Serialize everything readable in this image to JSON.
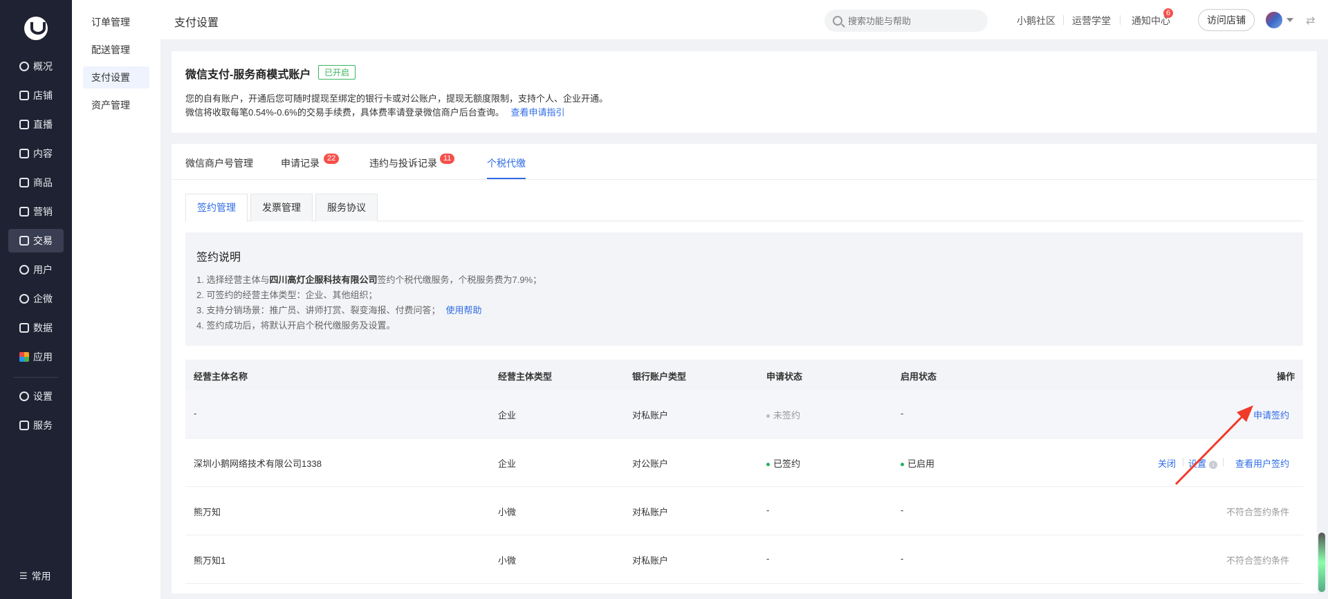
{
  "nav": {
    "items": [
      {
        "label": "概况",
        "icon": "clock-icon"
      },
      {
        "label": "店铺",
        "icon": "store-icon"
      },
      {
        "label": "直播",
        "icon": "live-icon"
      },
      {
        "label": "内容",
        "icon": "document-icon"
      },
      {
        "label": "商品",
        "icon": "box-icon"
      },
      {
        "label": "营销",
        "icon": "megaphone-icon"
      },
      {
        "label": "交易",
        "icon": "exchange-icon"
      },
      {
        "label": "用户",
        "icon": "user-icon"
      },
      {
        "label": "企微",
        "icon": "chat-icon"
      },
      {
        "label": "数据",
        "icon": "chart-icon"
      },
      {
        "label": "应用",
        "icon": "apps-icon"
      },
      {
        "label": "设置",
        "icon": "gear-icon"
      },
      {
        "label": "服务",
        "icon": "service-icon"
      }
    ],
    "active": "交易",
    "bottom_label": "常用"
  },
  "submenu": {
    "items": [
      "订单管理",
      "配送管理",
      "支付设置",
      "资产管理"
    ],
    "active": "支付设置"
  },
  "topbar": {
    "title": "支付设置",
    "search_placeholder": "搜索功能与帮助",
    "links": [
      "小鹅社区",
      "运营学堂",
      "通知中心"
    ],
    "notify_count": "6",
    "visit_label": "访问店铺"
  },
  "account": {
    "title": "微信支付-服务商模式账户",
    "status_tag": "已开启",
    "desc1": "您的自有账户，开通后您可随时提现至绑定的银行卡或对公账户，提现无额度限制，支持个人、企业开通。",
    "desc2": "微信将收取每笔0.54%-0.6%的交易手续费，具体费率请登录微信商户后台查询。",
    "guide_link": "查看申请指引"
  },
  "tabs": [
    {
      "label": "微信商户号管理",
      "badge": ""
    },
    {
      "label": "申请记录",
      "badge": "22"
    },
    {
      "label": "违约与投诉记录",
      "badge": "11"
    },
    {
      "label": "个税代缴",
      "badge": ""
    }
  ],
  "active_tab": "个税代缴",
  "subtabs": [
    "签约管理",
    "发票管理",
    "服务协议"
  ],
  "notice": {
    "title": "签约说明",
    "line1_pre": "1. 选择经营主体与",
    "line1_bold": "四川高灯企服科技有限公司",
    "line1_post": "签约个税代缴服务，个税服务费为7.9%；",
    "line2": "2. 可签约的经营主体类型：企业、其他组织；",
    "line3": "3. 支持分销场景：推广员、讲师打赏、裂变海报、付费问答；",
    "line3_link": "使用帮助",
    "line4": "4. 签约成功后，将默认开启个税代缴服务及设置。"
  },
  "table": {
    "headers": [
      "经营主体名称",
      "经营主体类型",
      "银行账户类型",
      "申请状态",
      "启用状态",
      "操作"
    ],
    "rows": [
      {
        "name": "-",
        "type": "企业",
        "bank": "对私账户",
        "apply": "未签约",
        "enable": "-",
        "action": "申请签约"
      },
      {
        "name": "深圳小鹅网络技术有限公司1338",
        "type": "企业",
        "bank": "对公账户",
        "apply": "已签约",
        "enable": "已启用",
        "actions": [
          "关闭",
          "设置",
          "查看用户签约"
        ]
      },
      {
        "name": "熊万知",
        "type": "小微",
        "bank": "对私账户",
        "apply": "-",
        "enable": "-",
        "action": "不符合签约条件"
      },
      {
        "name": "熊万知1",
        "type": "小微",
        "bank": "对私账户",
        "apply": "-",
        "enable": "-",
        "action": "不符合签约条件"
      }
    ]
  },
  "colors": {
    "accent": "#2e6be6",
    "nav_bg": "#1f2232",
    "success": "#21b35a",
    "alert": "#f5504b",
    "arrow": "#f03a2a"
  }
}
